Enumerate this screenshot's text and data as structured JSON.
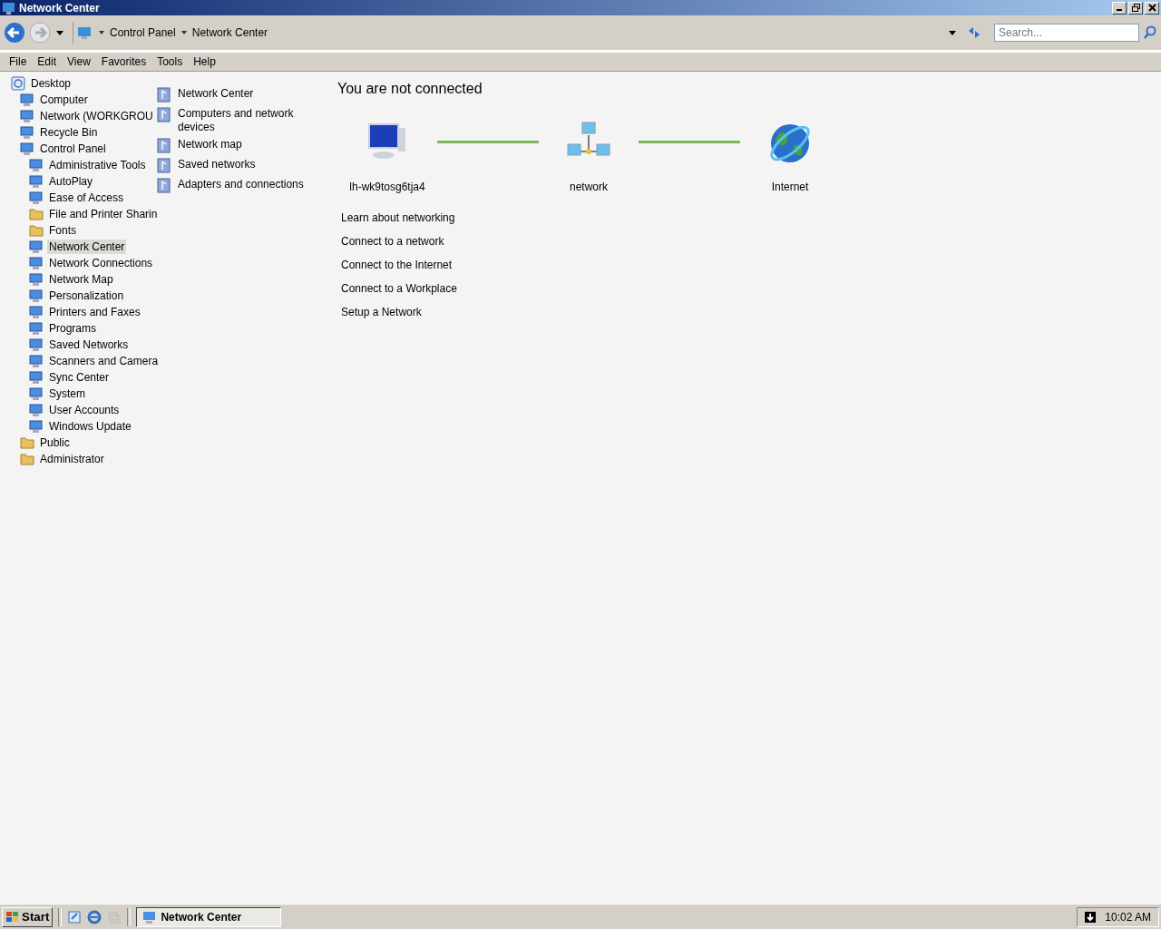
{
  "window": {
    "title": "Network Center"
  },
  "address_bar": {
    "crumbs": [
      "Control Panel",
      "Network Center"
    ],
    "search": {
      "placeholder": "Search..."
    }
  },
  "menu": [
    "File",
    "Edit",
    "View",
    "Favorites",
    "Tools",
    "Help"
  ],
  "tree": [
    {
      "label": "Desktop",
      "kind": "desktop",
      "selected": false,
      "children": [
        {
          "label": "Computer",
          "kind": "item",
          "selected": false
        },
        {
          "label": "Network (WORKGROU",
          "kind": "item",
          "selected": false
        },
        {
          "label": "Recycle Bin",
          "kind": "item",
          "selected": false
        },
        {
          "label": "Control Panel",
          "kind": "item",
          "selected": false,
          "children": [
            {
              "label": "Administrative Tools",
              "kind": "item",
              "selected": false
            },
            {
              "label": "AutoPlay",
              "kind": "item",
              "selected": false
            },
            {
              "label": "Ease of Access",
              "kind": "item",
              "selected": false
            },
            {
              "label": "File and Printer Sharin",
              "kind": "folder",
              "selected": false
            },
            {
              "label": "Fonts",
              "kind": "folder",
              "selected": false
            },
            {
              "label": "Network Center",
              "kind": "item",
              "selected": true
            },
            {
              "label": "Network Connections",
              "kind": "item",
              "selected": false
            },
            {
              "label": "Network Map",
              "kind": "item",
              "selected": false
            },
            {
              "label": "Personalization",
              "kind": "item",
              "selected": false
            },
            {
              "label": "Printers and Faxes",
              "kind": "item",
              "selected": false
            },
            {
              "label": "Programs",
              "kind": "item",
              "selected": false
            },
            {
              "label": "Saved Networks",
              "kind": "item",
              "selected": false
            },
            {
              "label": "Scanners and Camera",
              "kind": "item",
              "selected": false
            },
            {
              "label": "Sync Center",
              "kind": "item",
              "selected": false
            },
            {
              "label": "System",
              "kind": "item",
              "selected": false
            },
            {
              "label": "User Accounts",
              "kind": "item",
              "selected": false
            },
            {
              "label": "Windows Update",
              "kind": "item",
              "selected": false
            }
          ]
        },
        {
          "label": "Public",
          "kind": "folder",
          "selected": false
        },
        {
          "label": "Administrator",
          "kind": "folder",
          "selected": false
        }
      ]
    }
  ],
  "tasks": [
    "Network Center",
    "Computers and network devices",
    "Network map",
    "Saved networks",
    "Adapters and connections"
  ],
  "status": {
    "heading": "You are not connected",
    "nodes": [
      {
        "label": "lh-wk9tosg6tja4",
        "kind": "computer"
      },
      {
        "label": "network",
        "kind": "network"
      },
      {
        "label": "Internet",
        "kind": "internet"
      }
    ]
  },
  "links": [
    "Learn about networking",
    "Connect to a network",
    "Connect to the Internet",
    "Connect to a Workplace",
    "Setup a Network"
  ],
  "taskbar": {
    "start": "Start",
    "windows": [
      {
        "label": "Network Center",
        "selected": true
      }
    ],
    "clock": "10:02 AM"
  }
}
